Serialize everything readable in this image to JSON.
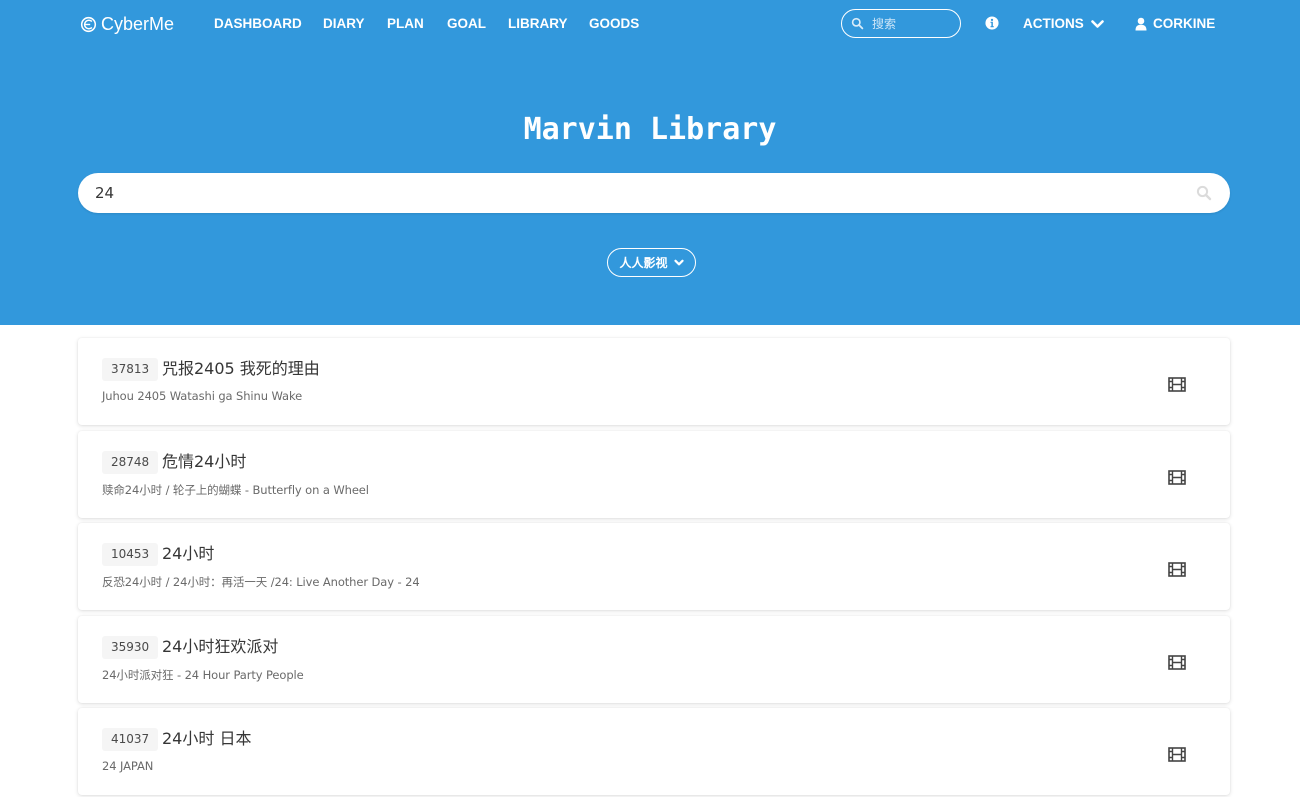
{
  "brand": {
    "name": "CyberMe",
    "logo_icon": "cyberme-logo-icon"
  },
  "nav": {
    "items": [
      {
        "label": "DASHBOARD"
      },
      {
        "label": "DIARY"
      },
      {
        "label": "PLAN"
      },
      {
        "label": "GOAL"
      },
      {
        "label": "LIBRARY"
      },
      {
        "label": "GOODS"
      }
    ],
    "search_placeholder": "搜索",
    "search_value": "",
    "actions_label": "ACTIONS",
    "user_label": "CORKINE"
  },
  "hero": {
    "title": "Marvin Library",
    "search_value": "24",
    "source_selected": "人人影视"
  },
  "colors": {
    "primary": "#3298dc",
    "card_bg": "#ffffff",
    "tag_bg": "#f5f5f5"
  },
  "results": [
    {
      "id": "37813",
      "title": "咒报2405 我死的理由",
      "subtitle": "Juhou 2405 Watashi ga Shinu Wake",
      "icon": "film-icon"
    },
    {
      "id": "28748",
      "title": "危情24小时",
      "subtitle": "赎命24小时 / 轮子上的蝴蝶 - Butterfly on a Wheel",
      "icon": "film-icon"
    },
    {
      "id": "10453",
      "title": "24小时",
      "subtitle": "反恐24小时 / 24小时：再活一天 /24: Live Another Day - 24",
      "icon": "film-icon"
    },
    {
      "id": "35930",
      "title": "24小时狂欢派对",
      "subtitle": "24小时派对狂 - 24 Hour Party People",
      "icon": "film-icon"
    },
    {
      "id": "41037",
      "title": "24小时 日本",
      "subtitle": "24 JAPAN",
      "icon": "film-icon"
    }
  ]
}
